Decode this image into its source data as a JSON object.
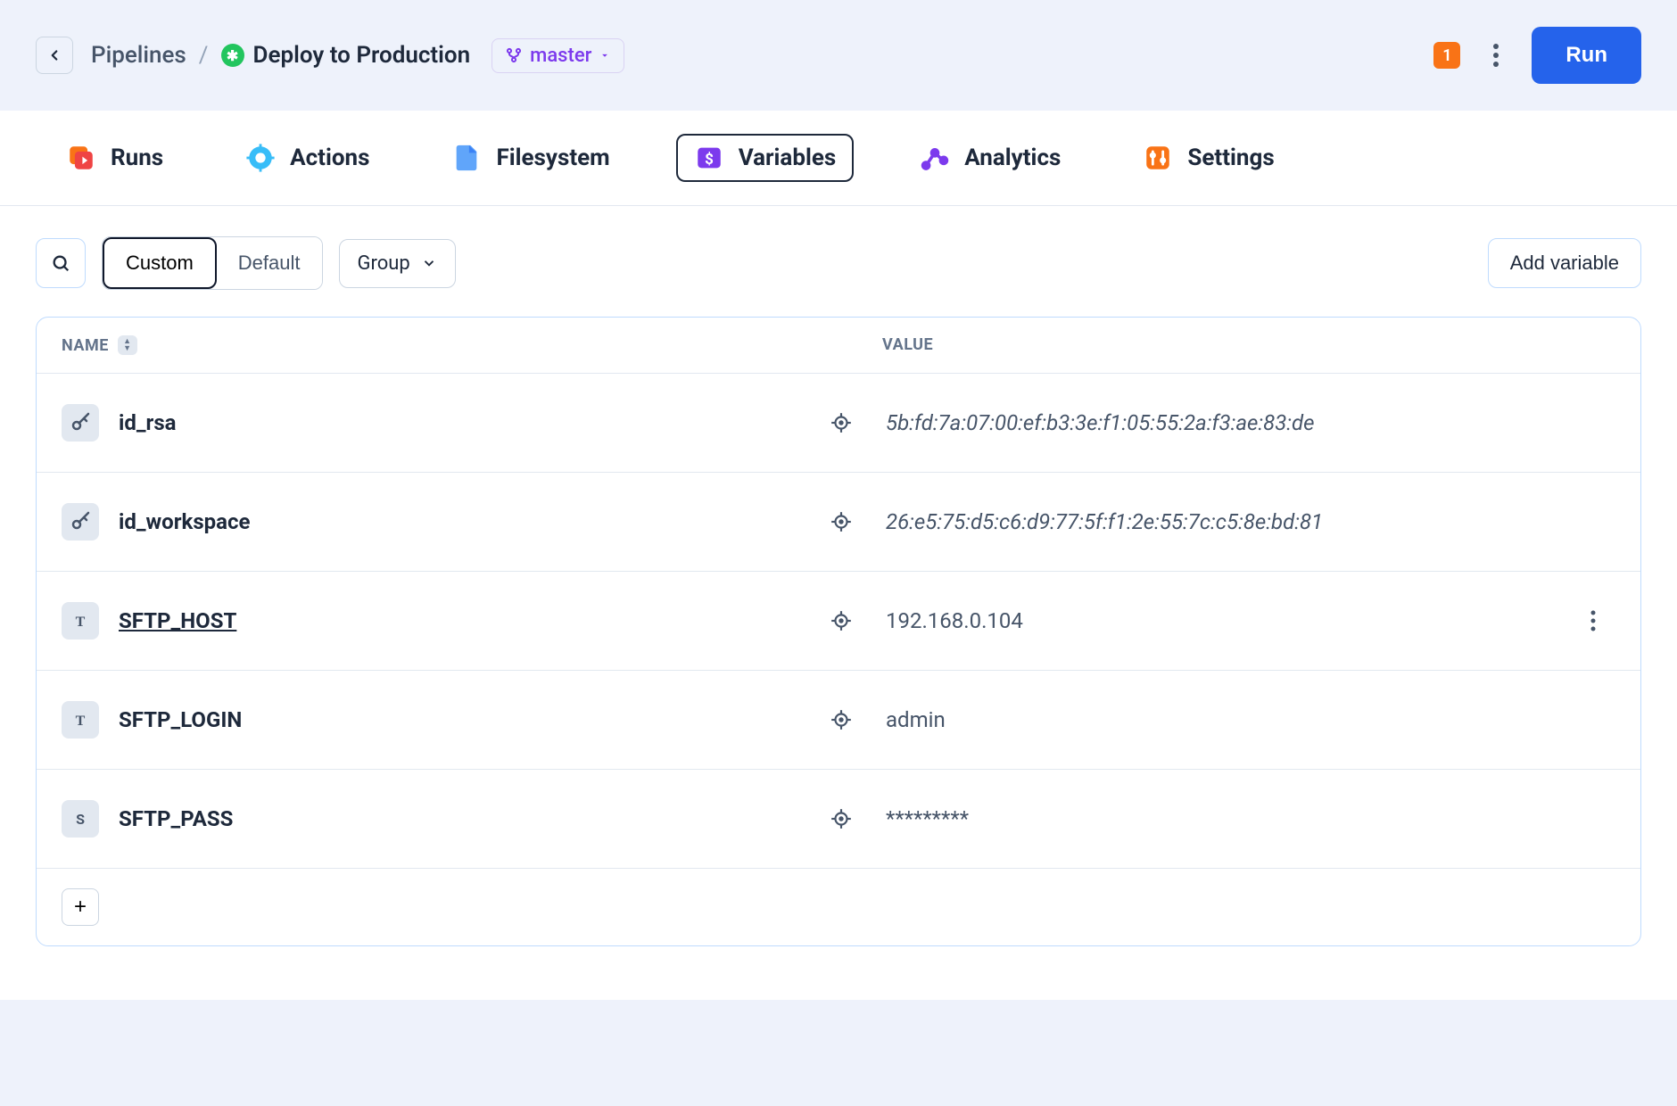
{
  "header": {
    "breadcrumb_link": "Pipelines",
    "breadcrumb_sep": "/",
    "page_title": "Deploy to Production",
    "branch_label": "master",
    "notif_count": "1",
    "run_label": "Run"
  },
  "tabs": [
    {
      "label": "Runs"
    },
    {
      "label": "Actions"
    },
    {
      "label": "Filesystem"
    },
    {
      "label": "Variables"
    },
    {
      "label": "Analytics"
    },
    {
      "label": "Settings"
    }
  ],
  "toolbar": {
    "filter1": "Custom",
    "filter2": "Default",
    "group": "Group",
    "add_variable": "Add variable"
  },
  "table": {
    "header_name": "NAME",
    "header_value": "VALUE",
    "rows": [
      {
        "icon": "key",
        "name": "id_rsa",
        "value": "5b:fd:7a:07:00:ef:b3:3e:f1:05:55:2a:f3:ae:83:de",
        "italic": true,
        "underline": false,
        "actions": false
      },
      {
        "icon": "key",
        "name": "id_workspace",
        "value": "26:e5:75:d5:c6:d9:77:5f:f1:2e:55:7c:c5:8e:bd:81",
        "italic": true,
        "underline": false,
        "actions": false
      },
      {
        "icon": "text",
        "name": "SFTP_HOST",
        "value": "192.168.0.104",
        "italic": false,
        "underline": true,
        "actions": true
      },
      {
        "icon": "text",
        "name": "SFTP_LOGIN",
        "value": "admin",
        "italic": false,
        "underline": false,
        "actions": false
      },
      {
        "icon": "secret",
        "name": "SFTP_PASS",
        "value": "*********",
        "italic": false,
        "underline": false,
        "actions": false
      }
    ]
  }
}
